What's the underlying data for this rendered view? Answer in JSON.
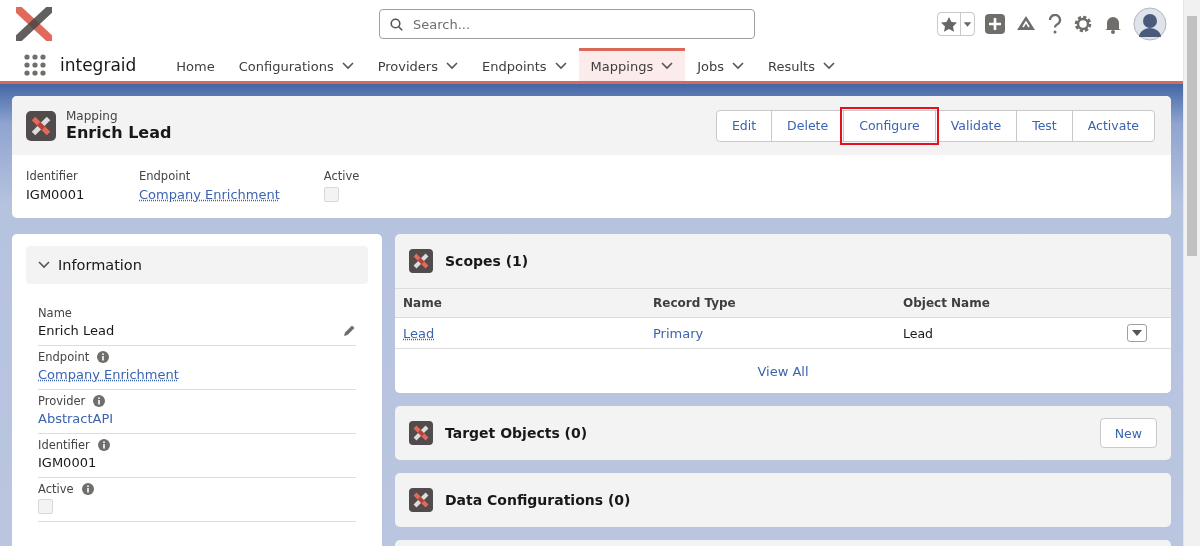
{
  "header": {
    "search": {
      "placeholder": "Search..."
    }
  },
  "nav": {
    "app_name": "integraid",
    "items": [
      {
        "label": "Home",
        "dropdown": false,
        "selected": false
      },
      {
        "label": "Configurations",
        "dropdown": true,
        "selected": false
      },
      {
        "label": "Providers",
        "dropdown": true,
        "selected": false
      },
      {
        "label": "Endpoints",
        "dropdown": true,
        "selected": false
      },
      {
        "label": "Mappings",
        "dropdown": true,
        "selected": true
      },
      {
        "label": "Jobs",
        "dropdown": true,
        "selected": false
      },
      {
        "label": "Results",
        "dropdown": true,
        "selected": false
      }
    ]
  },
  "record": {
    "object_type": "Mapping",
    "title": "Enrich Lead",
    "actions": [
      {
        "label": "Edit",
        "highlighted": false
      },
      {
        "label": "Delete",
        "highlighted": false
      },
      {
        "label": "Configure",
        "highlighted": true
      },
      {
        "label": "Validate",
        "highlighted": false
      },
      {
        "label": "Test",
        "highlighted": false
      },
      {
        "label": "Activate",
        "highlighted": false
      }
    ],
    "highlights": [
      {
        "label": "Identifier",
        "kind": "text",
        "value": "IGM0001"
      },
      {
        "label": "Endpoint",
        "kind": "link",
        "value": "Company Enrichment"
      },
      {
        "label": "Active",
        "kind": "checkbox",
        "checked": false
      }
    ]
  },
  "information": {
    "title": "Information",
    "expanded": true,
    "fields": [
      {
        "label": "Name",
        "kind": "text",
        "value": "Enrich Lead",
        "info": false,
        "editable": true
      },
      {
        "label": "Endpoint",
        "kind": "link",
        "value": "Company Enrichment",
        "info": true,
        "editable": false
      },
      {
        "label": "Provider",
        "kind": "plainlink",
        "value": "AbstractAPI",
        "info": true,
        "editable": false
      },
      {
        "label": "Identifier",
        "kind": "text",
        "value": "IGM0001",
        "info": true,
        "editable": false
      },
      {
        "label": "Active",
        "kind": "checkbox",
        "checked": false,
        "info": true,
        "editable": false
      }
    ]
  },
  "related": [
    {
      "title": "Scopes (1)",
      "columns": [
        "Name",
        "Record Type",
        "Object Name"
      ],
      "rows": [
        {
          "cells": [
            {
              "kind": "link",
              "text": "Lead"
            },
            {
              "kind": "plainlink",
              "text": "Primary"
            },
            {
              "kind": "text",
              "text": "Lead"
            }
          ]
        }
      ],
      "footer_link": "View All"
    },
    {
      "title": "Target Objects (0)",
      "button": "New"
    },
    {
      "title": "Data Configurations (0)"
    }
  ]
}
